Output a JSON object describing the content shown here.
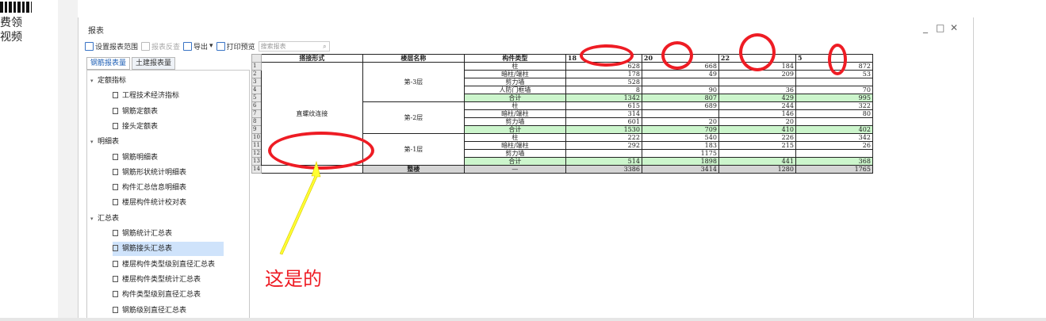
{
  "left_strip": {
    "text_line1": "费领",
    "text_line2": "视频"
  },
  "window": {
    "title": "报表",
    "controls": [
      "_",
      "□",
      "✕"
    ]
  },
  "toolbar": {
    "set_range": "设置报表范围",
    "report_reverse": "报表反查",
    "export": "导出",
    "export_arrow": "▾",
    "print_preview": "打印预览",
    "search_placeholder": "搜索报表"
  },
  "tabs": {
    "steel": "钢筋报表量",
    "civil": "土建报表量"
  },
  "tree": [
    {
      "label": "定额指标",
      "level": 0,
      "expanded": true
    },
    {
      "label": "工程技术经济指标",
      "level": 1
    },
    {
      "label": "钢筋定额表",
      "level": 1
    },
    {
      "label": "接头定额表",
      "level": 1
    },
    {
      "label": "明细表",
      "level": 0,
      "expanded": true
    },
    {
      "label": "钢筋明细表",
      "level": 1
    },
    {
      "label": "钢筋形状统计明细表",
      "level": 1
    },
    {
      "label": "构件汇总信息明细表",
      "level": 1
    },
    {
      "label": "楼层构件统计校对表",
      "level": 1
    },
    {
      "label": "汇总表",
      "level": 0,
      "expanded": true
    },
    {
      "label": "钢筋统计汇总表",
      "level": 1
    },
    {
      "label": "钢筋接头汇总表",
      "level": 1,
      "selected": true
    },
    {
      "label": "楼层构件类型级别直径汇总表",
      "level": 1
    },
    {
      "label": "楼层构件类型统计汇总表",
      "level": 1
    },
    {
      "label": "构件类型级别直径汇总表",
      "level": 1
    },
    {
      "label": "钢筋级别直径汇总表",
      "level": 1
    }
  ],
  "table": {
    "headers": {
      "conn": "搭接形式",
      "floor": "楼层名称",
      "comp": "构件类型",
      "d1": "18",
      "d2": "20",
      "d3": "22",
      "d4": "5"
    },
    "row_numbers": [
      "1",
      "2",
      "3",
      "4",
      "5",
      "6",
      "7",
      "8",
      "9",
      "10",
      "11",
      "12",
      "13",
      "14"
    ],
    "conn_value": "直螺纹连接",
    "floors": [
      "第-3层",
      "第-2层",
      "第-1层"
    ],
    "total_floor": "整楼",
    "total_comp": "—",
    "rows": [
      {
        "comp": "柱",
        "v": [
          "628",
          "668",
          "184",
          "872"
        ]
      },
      {
        "comp": "暗柱/端柱",
        "v": [
          "178",
          "49",
          "209",
          "53"
        ]
      },
      {
        "comp": "剪力墙",
        "v": [
          "528",
          "",
          "",
          ""
        ]
      },
      {
        "comp": "人防门框墙",
        "v": [
          "8",
          "90",
          "36",
          "70"
        ]
      },
      {
        "comp": "合计",
        "v": [
          "1342",
          "807",
          "429",
          "995"
        ],
        "sum": true
      },
      {
        "comp": "柱",
        "v": [
          "615",
          "689",
          "244",
          "322"
        ]
      },
      {
        "comp": "暗柱/端柱",
        "v": [
          "314",
          "",
          "146",
          "80"
        ]
      },
      {
        "comp": "剪力墙",
        "v": [
          "601",
          "20",
          "20",
          ""
        ]
      },
      {
        "comp": "合计",
        "v": [
          "1530",
          "709",
          "410",
          "402"
        ],
        "sum": true
      },
      {
        "comp": "柱",
        "v": [
          "222",
          "540",
          "226",
          "342"
        ]
      },
      {
        "comp": "暗柱/端柱",
        "v": [
          "292",
          "183",
          "215",
          "26"
        ]
      },
      {
        "comp": "剪力墙",
        "v": [
          "",
          "1175",
          "",
          ""
        ]
      },
      {
        "comp": "合计",
        "v": [
          "514",
          "1898",
          "441",
          "368"
        ],
        "sum": true
      },
      {
        "comp": "",
        "v": [
          "3386",
          "3414",
          "1280",
          "1765"
        ],
        "total": true
      }
    ]
  },
  "annotation": {
    "note": "这是的",
    "color": "#ee1c24",
    "arrow_color": "#ffff33"
  }
}
